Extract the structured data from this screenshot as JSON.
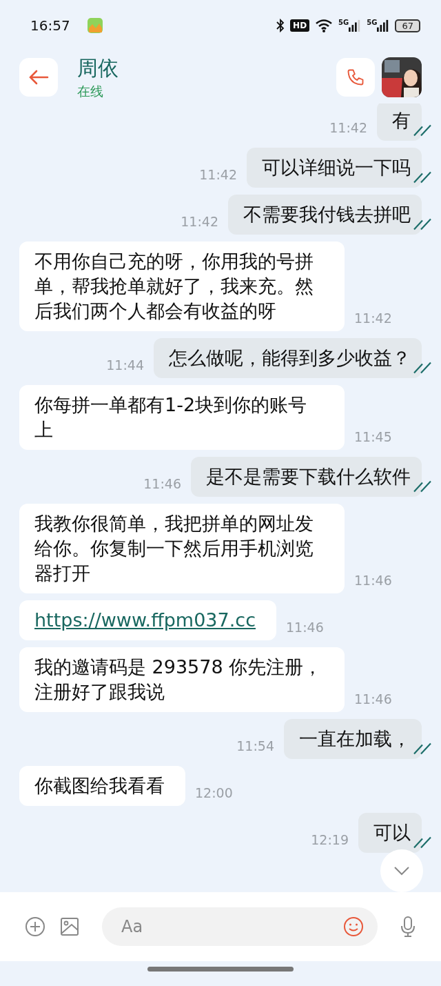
{
  "status_bar": {
    "time": "16:57",
    "hd": "HD",
    "networks": [
      "5G",
      "5G"
    ],
    "battery": "67"
  },
  "header": {
    "name": "周依",
    "presence": "在线"
  },
  "messages": [
    {
      "outgoing": true,
      "kind": "text",
      "text": "有",
      "time": "11:42",
      "read": true
    },
    {
      "outgoing": true,
      "kind": "text",
      "text": "可以详细说一下吗",
      "time": "11:42",
      "read": true
    },
    {
      "outgoing": true,
      "kind": "text",
      "text": "不需要我付钱去拼吧",
      "time": "11:42",
      "read": true
    },
    {
      "outgoing": false,
      "kind": "text",
      "text": "不用你自己充的呀，你用我的号拼单，帮我抢单就好了，我来充。然后我们两个人都会有收益的呀",
      "time": "11:42"
    },
    {
      "outgoing": true,
      "kind": "text",
      "text": "怎么做呢，能得到多少收益？",
      "time": "11:44",
      "read": true
    },
    {
      "outgoing": false,
      "kind": "text",
      "text": "你每拼一单都有1-2块到你的账号上",
      "time": "11:45"
    },
    {
      "outgoing": true,
      "kind": "text",
      "text": "是不是需要下载什么软件",
      "time": "11:46",
      "read": true
    },
    {
      "outgoing": false,
      "kind": "text",
      "text": "我教你很简单，我把拼单的网址发给你。你复制一下然后用手机浏览器打开",
      "time": "11:46"
    },
    {
      "outgoing": false,
      "kind": "link",
      "text": "https://www.ffpm037.cc",
      "time": "11:46"
    },
    {
      "outgoing": false,
      "kind": "text",
      "text": "我的邀请码是 293578  你先注册，注册好了跟我说",
      "time": "11:46"
    },
    {
      "outgoing": true,
      "kind": "text",
      "text": "一直在加载，",
      "time": "11:54",
      "read": true
    },
    {
      "outgoing": false,
      "kind": "text",
      "text": "你截图给我看看",
      "time": "12:00"
    },
    {
      "outgoing": true,
      "kind": "text",
      "text": "可以",
      "time": "12:19",
      "read": true
    }
  ],
  "composer": {
    "placeholder": "Aa"
  }
}
